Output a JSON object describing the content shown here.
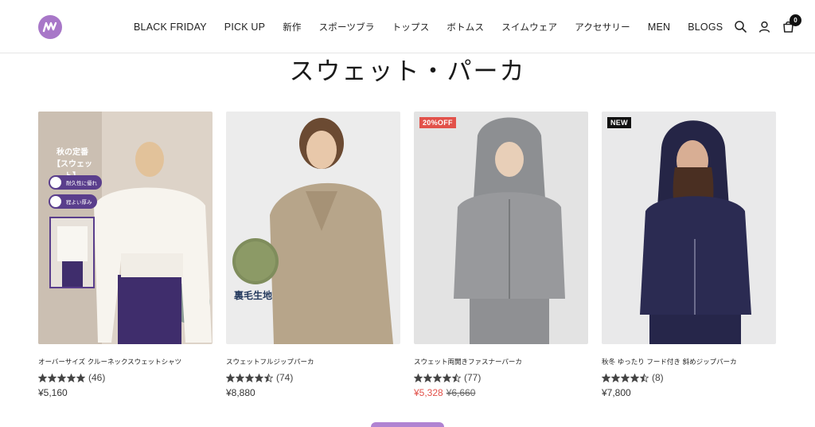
{
  "header": {
    "logo_icon": "brand-logo-icon",
    "nav": [
      {
        "label": "BLACK FRIDAY"
      },
      {
        "label": "PICK UP"
      },
      {
        "label": "新作"
      },
      {
        "label": "スポーツブラ"
      },
      {
        "label": "トップス"
      },
      {
        "label": "ボトムス"
      },
      {
        "label": "スイムウェア"
      },
      {
        "label": "アクセサリー"
      },
      {
        "label": "MEN"
      },
      {
        "label": "BLOGS"
      }
    ],
    "cart_count": "0",
    "icons": [
      "search-icon",
      "account-icon",
      "cart-icon"
    ]
  },
  "page": {
    "title": "スウェット・パーカ"
  },
  "products": [
    {
      "name": "オーバーサイズ クルーネックスウェットシャツ",
      "rating": 5,
      "reviews": "(46)",
      "price": "¥5,160",
      "overlay": {
        "title_line1": "秋の定番",
        "title_line2": "【スウェット】",
        "pill1": "耐久性に優れ",
        "pill2": "程よい厚み"
      }
    },
    {
      "name": "スウェットフルジップパーカ",
      "rating": 4.5,
      "reviews": "(74)",
      "price": "¥8,880",
      "overlay": {
        "fabric_label": "裏毛生地"
      }
    },
    {
      "name": "スウェット両開きファスナーパーカ",
      "rating": 4.5,
      "reviews": "(77)",
      "badge": "20%OFF",
      "sale_price": "¥5,328",
      "compare_price": "¥6,660"
    },
    {
      "name": "秋冬 ゆったり フード付き 斜めジップパーカ",
      "rating": 4.5,
      "reviews": "(8)",
      "badge": "NEW",
      "price": "¥7,800"
    }
  ],
  "colors": {
    "brand": "#a877c8",
    "sale": "#e2514a",
    "badge_new": "#111111"
  }
}
